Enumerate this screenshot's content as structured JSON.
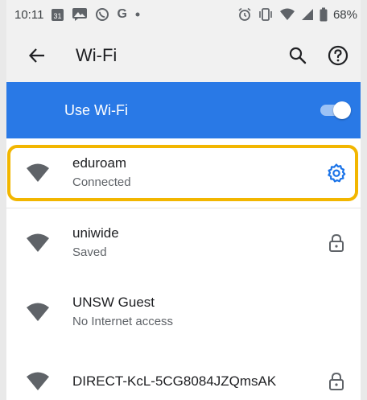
{
  "status_bar": {
    "time": "10:11",
    "left_icons": [
      "calendar-icon",
      "photo-message-icon",
      "whatsapp-icon",
      "google-icon",
      "dot-icon"
    ],
    "right_icons": [
      "alarm-icon",
      "vibrate-icon",
      "wifi-signal-icon",
      "cell-signal-icon",
      "battery-icon"
    ],
    "battery": "68%",
    "calendar_day": "31",
    "g_letter": "G"
  },
  "app_bar": {
    "title": "Wi-Fi"
  },
  "use_wifi": {
    "label": "Use Wi-Fi",
    "enabled": true
  },
  "networks": [
    {
      "name": "eduroam",
      "status": "Connected",
      "action_icon": "gear-icon",
      "highlighted": true
    },
    {
      "name": "uniwide",
      "status": "Saved",
      "action_icon": "lock-icon"
    },
    {
      "name": "UNSW Guest",
      "status": "No Internet access",
      "action_icon": ""
    },
    {
      "name": "DIRECT-KcL-5CG8084JZQmsAK",
      "status": "",
      "action_icon": "lock-icon"
    }
  ],
  "colors": {
    "accent": "#2979e6",
    "highlight": "#f2b600",
    "gear": "#1a73e8"
  }
}
